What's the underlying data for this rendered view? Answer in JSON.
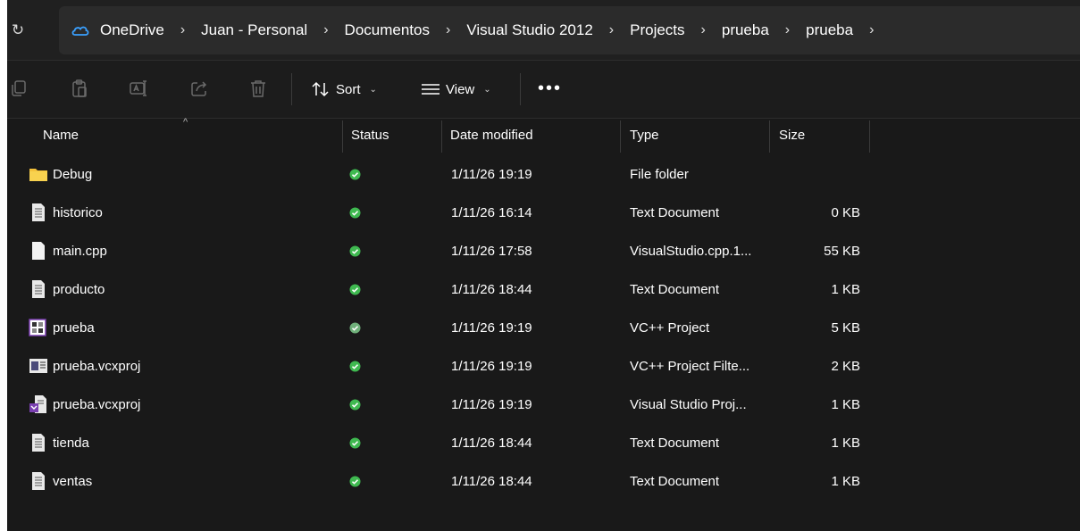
{
  "address": {
    "refresh_glyph": "↻",
    "crumbs": [
      "OneDrive",
      "Juan - Personal",
      "Documentos",
      "Visual Studio 2012",
      "Projects",
      "prueba",
      "prueba"
    ],
    "separator": "›"
  },
  "toolbar": {
    "sort_label": "Sort",
    "view_label": "View",
    "more_label": "•••"
  },
  "columns": {
    "name": "Name",
    "status": "Status",
    "date": "Date modified",
    "type": "Type",
    "size": "Size"
  },
  "files": [
    {
      "name": "Debug",
      "icon": "folder-icon",
      "date": "1/11/26 19:19",
      "type": "File folder",
      "size": ""
    },
    {
      "name": "historico",
      "icon": "text-document-icon",
      "date": "1/11/26 16:14",
      "type": "Text Document",
      "size": "0 KB"
    },
    {
      "name": "main.cpp",
      "icon": "blank-file-icon",
      "date": "1/11/26 17:58",
      "type": "VisualStudio.cpp.1...",
      "size": "55 KB"
    },
    {
      "name": "producto",
      "icon": "text-document-icon",
      "date": "1/11/26 18:44",
      "type": "Text Document",
      "size": "1 KB"
    },
    {
      "name": "prueba",
      "icon": "vc-project-icon",
      "date": "1/11/26 19:19",
      "type": "VC++ Project",
      "size": "5 KB"
    },
    {
      "name": "prueba.vcxproj",
      "icon": "vc-filters-icon",
      "date": "1/11/26 19:19",
      "type": "VC++ Project Filte...",
      "size": "2 KB"
    },
    {
      "name": "prueba.vcxproj",
      "icon": "vs-project-icon",
      "date": "1/11/26 19:19",
      "type": "Visual Studio Proj...",
      "size": "1 KB"
    },
    {
      "name": "tienda",
      "icon": "text-document-icon",
      "date": "1/11/26 18:44",
      "type": "Text Document",
      "size": "1 KB"
    },
    {
      "name": "ventas",
      "icon": "text-document-icon",
      "date": "1/11/26 18:44",
      "type": "Text Document",
      "size": "1 KB"
    }
  ],
  "colors": {
    "background": "#191919",
    "status_ok": "#3fb950",
    "folder": "#f4c23b",
    "onedrive_blue": "#3aa0ff"
  }
}
